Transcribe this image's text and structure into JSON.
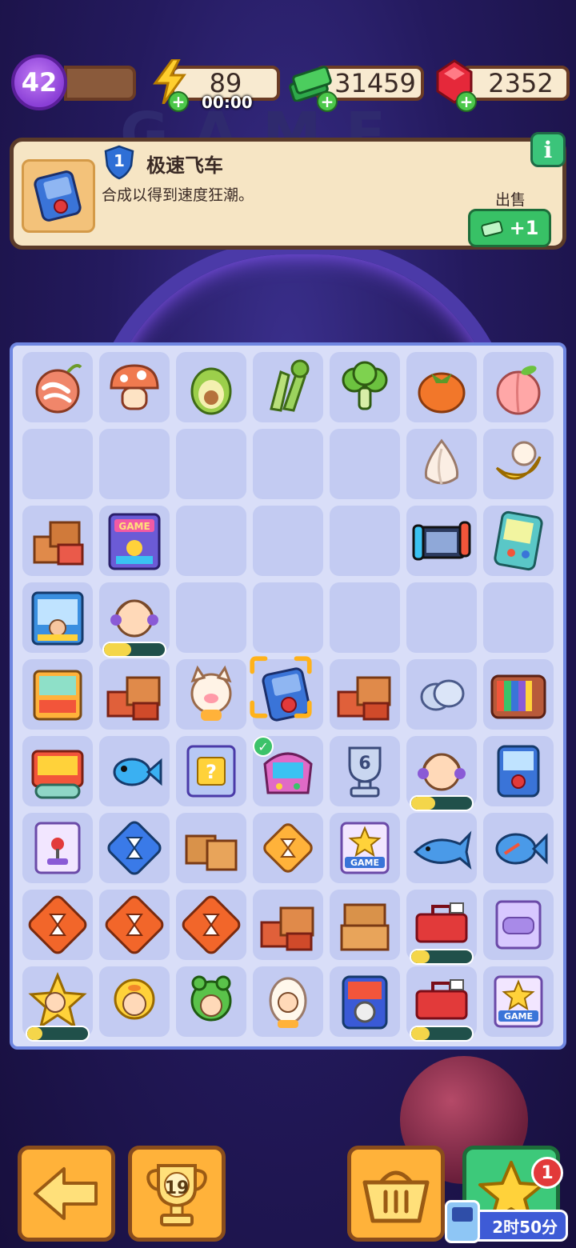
{
  "topbar": {
    "level": "42",
    "energy": "89",
    "energy_timer": "00:00",
    "cash": "31459",
    "gems": "2352"
  },
  "info": {
    "item_level": "1",
    "item_name": "极速飞车",
    "description": "合成以得到速度狂潮。",
    "sell_label": "出售",
    "sell_value": "+1",
    "info_icon": "i"
  },
  "board": {
    "rows": 9,
    "cols": 7,
    "cells": [
      [
        "onion",
        "mushroom",
        "avocado",
        "celery",
        "broccoli",
        "persimmon",
        "peach"
      ],
      [
        "",
        "",
        "",
        "",
        "",
        "garlic",
        "banana"
      ],
      [
        "boxes-stack",
        "arcade-poster",
        "",
        "",
        "",
        "game-console",
        "handheld-game"
      ],
      [
        "claw-machine",
        "idol-girl-1",
        "",
        "",
        "",
        "",
        ""
      ],
      [
        "arcade-machine-small",
        "box-pile",
        "pig-cat",
        "handheld-blue",
        "box-pile",
        "coins",
        "retro-tv"
      ],
      [
        "game-cabinet",
        "blue-fish",
        "question-card",
        "mini-arcade",
        "trophy",
        "idol-girl-2",
        "joystick-machine"
      ],
      [
        "arcade-card",
        "hourglass-blue",
        "box-pair",
        "hourglass-gold",
        "game-star-card",
        "shark",
        "blue-fish-2"
      ],
      [
        "hourglass-orange",
        "hourglass-orange",
        "hourglass-orange",
        "box-pile",
        "box-stack",
        "toolbox",
        "purple-card"
      ],
      [
        "star-girl",
        "duck-kid",
        "frog-kid",
        "egg-kid",
        "racing-arcade",
        "toolbox",
        "game-star-card"
      ]
    ],
    "progress": {
      "3-1": 0.45,
      "5-5": 0.4,
      "7-5": 0.3,
      "8-0": 0.25,
      "8-5": 0.3
    },
    "trophy_number": "6"
  },
  "bottom": {
    "back_icon": "arrow-left-icon",
    "trophy_count": "19",
    "basket_icon": "basket-icon",
    "star_notif": "1",
    "star_timer": "2时50分"
  }
}
